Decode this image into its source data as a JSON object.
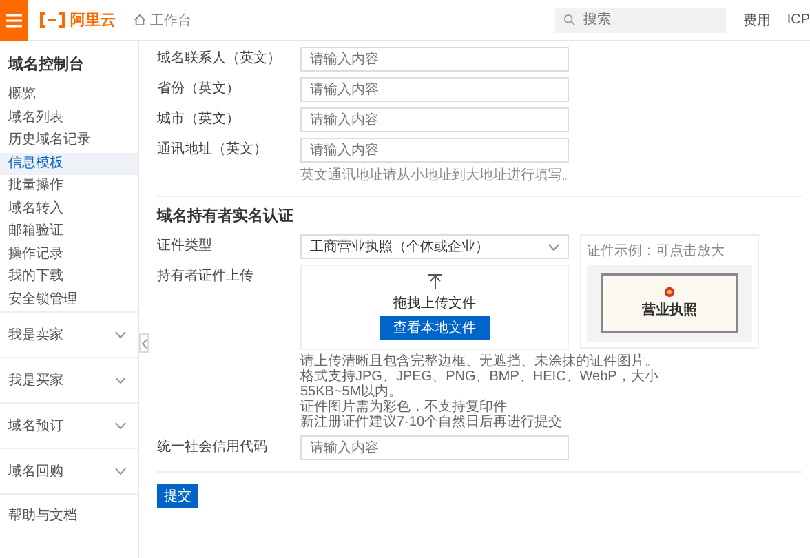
{
  "header": {
    "logo": "阿里云",
    "breadcrumb": "工作台",
    "search": {
      "placeholder": "搜索"
    },
    "links": [
      "费用",
      "ICP"
    ]
  },
  "sidebar": {
    "title": "域名控制台",
    "items": [
      {
        "label": "概览",
        "selected": false
      },
      {
        "label": "域名列表",
        "selected": false
      },
      {
        "label": "历史域名记录",
        "selected": false
      },
      {
        "label": "信息模板",
        "selected": true
      },
      {
        "label": "批量操作",
        "selected": false
      },
      {
        "label": "域名转入",
        "selected": false
      },
      {
        "label": "邮箱验证",
        "selected": false
      },
      {
        "label": "操作记录",
        "selected": false
      },
      {
        "label": "我的下载",
        "selected": false
      },
      {
        "label": "安全锁管理",
        "selected": false
      }
    ],
    "groups": [
      {
        "label": "我是卖家",
        "expanded": false
      },
      {
        "label": "我是买家",
        "expanded": false
      },
      {
        "label": "域名预订",
        "expanded": false
      },
      {
        "label": "域名回购",
        "expanded": false
      }
    ],
    "footer": "帮助与文档"
  },
  "fields": [
    {
      "label": "域名联系人（英文）",
      "placeholder": "请输入内容"
    },
    {
      "label": "省份（英文）",
      "placeholder": "请输入内容"
    },
    {
      "label": "城市（英文）",
      "placeholder": "请输入内容"
    },
    {
      "label": "通讯地址（英文）",
      "placeholder": "请输入内容",
      "hint": "英文通讯地址请从小地址到大地址进行填写。"
    }
  ],
  "section": {
    "title": "域名持有者实名认证",
    "cert_type": {
      "label": "证件类型",
      "value": "工商营业执照（个体或企业）"
    },
    "upload": {
      "label": "持有者证件上传",
      "drop_text": "拖拽上传文件",
      "button": "查看本地文件",
      "hints": [
        "请上传清晰且包含完整边框、无遮挡、未涂抹的证件图片。",
        "格式支持JPG、JPEG、PNG、BMP、HEIC、WebP，大小55KB~5M以内。",
        "证件图片需为彩色，不支持复印件",
        "新注册证件建议7-10个自然日后再进行提交"
      ]
    },
    "example": {
      "caption": "证件示例：可点击放大",
      "license_title": "营业执照"
    },
    "credit_code": {
      "label": "统一社会信用代码",
      "placeholder": "请输入内容"
    }
  },
  "submit": "提交"
}
